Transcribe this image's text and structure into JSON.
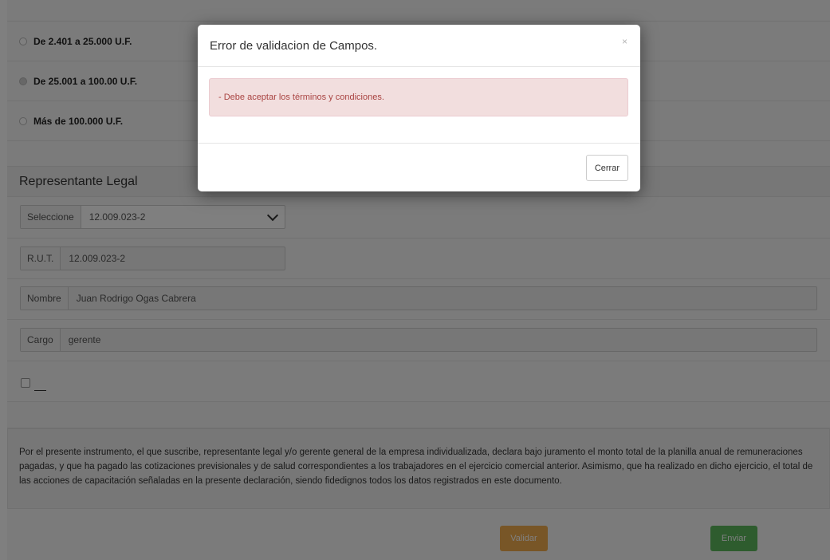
{
  "form": {
    "radios": [
      {
        "label": "De 2.401 a 25.000 U.F.",
        "checked": false
      },
      {
        "label": "De 25.001 a 100.00 U.F.",
        "checked": true
      },
      {
        "label": "Más de 100.000 U.F.",
        "checked": false
      }
    ],
    "section_title": "Representante Legal",
    "selecciona": {
      "addon": "Seleccione",
      "value": "12.009.023-2"
    },
    "rut": {
      "addon": "R.U.T.",
      "value": "12.009.023-2"
    },
    "nombre": {
      "addon": "Nombre",
      "value": "Juan Rodrigo Ogas Cabrera"
    },
    "cargo": {
      "addon": "Cargo",
      "value": "gerente"
    },
    "legal_text": "Por el presente instrumento, el que suscribe, representante legal y/o gerente general de la empresa individualizada, declara bajo juramento el monto total de la planilla anual de remuneraciones pagadas, y que ha pagado las cotizaciones previsionales y de salud correspondientes a los trabajadores en el ejercicio comercial anterior. Asimismo, que ha realizado en dicho ejercicio, el total de las acciones de capacitación señaladas en la presente declaración, siendo fidedignos todos los datos registrados en este documento.",
    "validar_label": "Validar",
    "enviar_label": "Enviar"
  },
  "modal": {
    "title": "Error de validacion de Campos.",
    "close_symbol": "×",
    "error_message": "- Debe aceptar los términos y condiciones.",
    "close_button": "Cerrar"
  },
  "colors": {
    "validar": "#f0ad4e",
    "enviar": "#5cb85c",
    "alert_bg": "#f2dede",
    "alert_text": "#a94442"
  }
}
